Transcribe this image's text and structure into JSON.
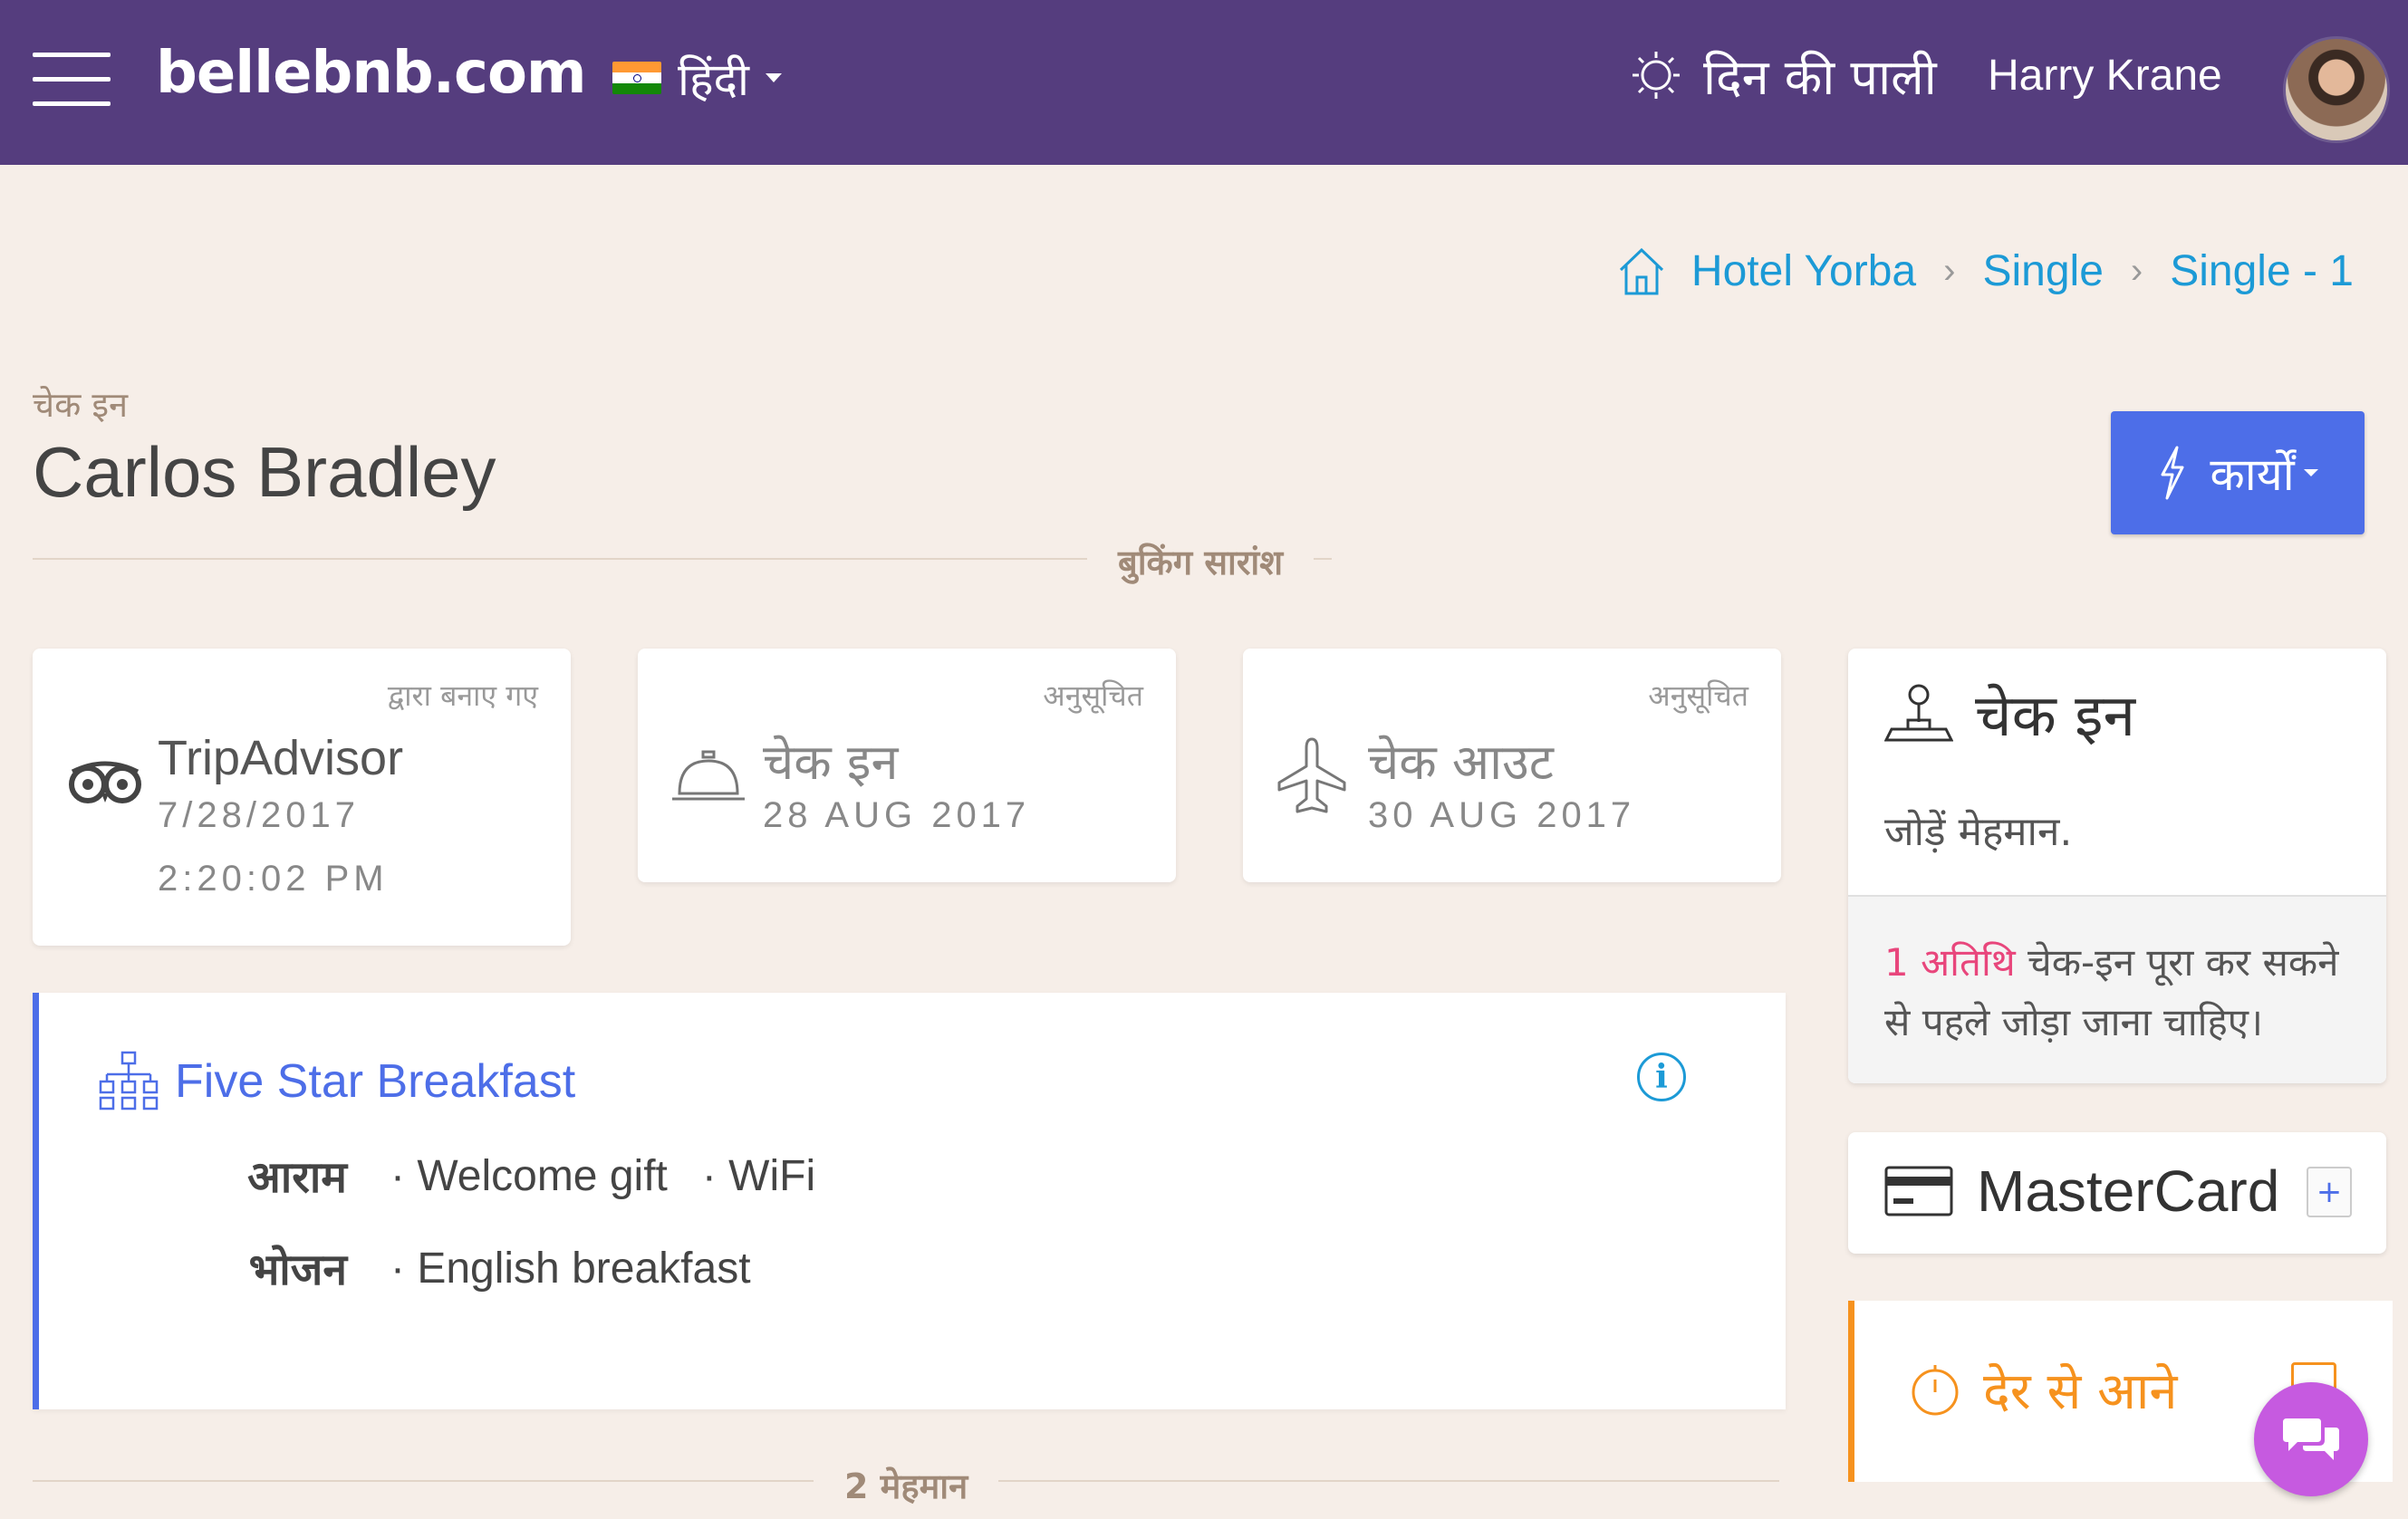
{
  "header": {
    "brand": "bellebnb.com",
    "language": "हिंदी",
    "shift": "दिन की पाली",
    "user": "Harry Krane"
  },
  "breadcrumb": [
    "Hotel Yorba",
    "Single",
    "Single - 1"
  ],
  "page": {
    "kicker": "चेक इन",
    "title": "Carlos Bradley",
    "actions_label": "कार्यों"
  },
  "booking_summary_label": "बुकिंग सारांश",
  "summary_cards": [
    {
      "tag": "द्वारा बनाए गए",
      "main": "TripAdvisor",
      "sub": "7/28/2017",
      "sub2": "2:20:02 PM",
      "icon": "tripadvisor-icon"
    },
    {
      "tag": "अनुसूचित",
      "main": "चेक इन",
      "sub": "28 AUG 2017",
      "icon": "reception-bell-icon"
    },
    {
      "tag": "अनुसूचित",
      "main": "चेक आउट",
      "sub": "30 AUG 2017",
      "icon": "airplane-icon"
    }
  ],
  "package": {
    "title": "Five Star Breakfast",
    "rows": [
      {
        "label": "आराम",
        "items": [
          "· Welcome gift",
          "· WiFi"
        ]
      },
      {
        "label": "भोजन",
        "items": [
          "· English breakfast"
        ]
      }
    ]
  },
  "guests_label": "2 मेहमान",
  "checkin_panel": {
    "title": "चेक इन",
    "add_guests": "जोड़ें मेहमान.",
    "notice_highlight": "1 अतिथि",
    "notice_line1_rest": " चेक-इन पूरा कर सकने",
    "notice_line2": "से पहले जोड़ा जाना चाहिए।"
  },
  "payment": {
    "card": "MasterCard",
    "add": "+"
  },
  "late": {
    "label": "देर से आने"
  },
  "colors": {
    "header": "#553d7e",
    "accent": "#4d6ee8",
    "link": "#1c9ad6",
    "pink": "#e8467c",
    "orange": "#f6921e",
    "chat": "#c65ae0"
  }
}
